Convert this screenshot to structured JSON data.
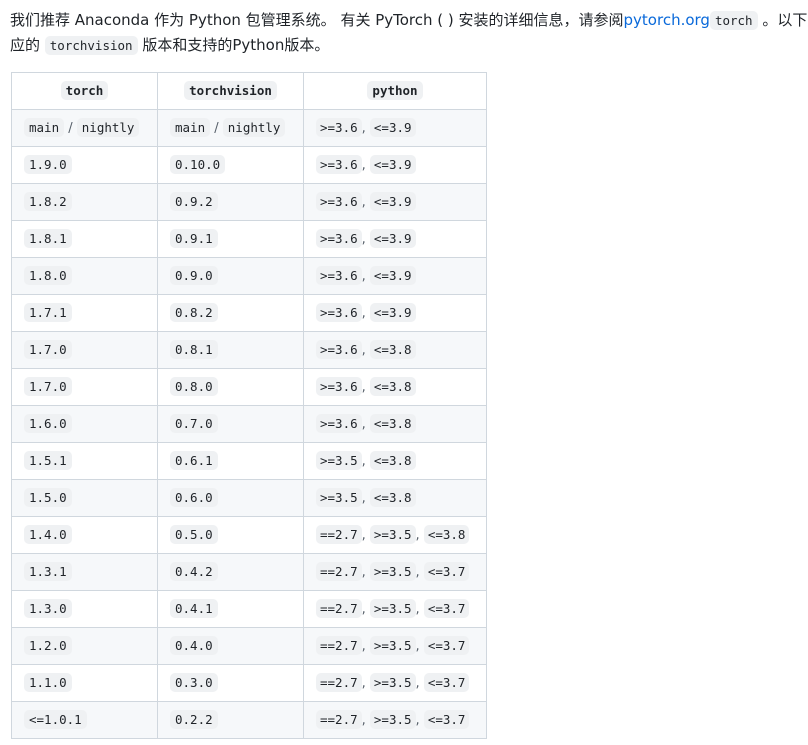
{
  "intro": {
    "line1_text": "我们推荐 Anaconda 作为 Python 包管理系统。 有关 PyTorch ( ) 安装的详细信息，请参阅",
    "link_text": "pytorch.org",
    "code_torch": "torch",
    "line1_tail": " 。以下是相",
    "line2_prefix": "应的 ",
    "code_torchvision": "torchvision",
    "line2_suffix": " 版本和支持的Python版本。"
  },
  "table": {
    "headers": [
      "torch",
      "torchvision",
      "python"
    ],
    "rows": [
      {
        "torch": [
          "main",
          "nightly"
        ],
        "torchvision": [
          "main",
          "nightly"
        ],
        "python": [
          ">=3.6",
          "<=3.9"
        ]
      },
      {
        "torch": [
          "1.9.0"
        ],
        "torchvision": [
          "0.10.0"
        ],
        "python": [
          ">=3.6",
          "<=3.9"
        ]
      },
      {
        "torch": [
          "1.8.2"
        ],
        "torchvision": [
          "0.9.2"
        ],
        "python": [
          ">=3.6",
          "<=3.9"
        ]
      },
      {
        "torch": [
          "1.8.1"
        ],
        "torchvision": [
          "0.9.1"
        ],
        "python": [
          ">=3.6",
          "<=3.9"
        ]
      },
      {
        "torch": [
          "1.8.0"
        ],
        "torchvision": [
          "0.9.0"
        ],
        "python": [
          ">=3.6",
          "<=3.9"
        ]
      },
      {
        "torch": [
          "1.7.1"
        ],
        "torchvision": [
          "0.8.2"
        ],
        "python": [
          ">=3.6",
          "<=3.9"
        ]
      },
      {
        "torch": [
          "1.7.0"
        ],
        "torchvision": [
          "0.8.1"
        ],
        "python": [
          ">=3.6",
          "<=3.8"
        ]
      },
      {
        "torch": [
          "1.7.0"
        ],
        "torchvision": [
          "0.8.0"
        ],
        "python": [
          ">=3.6",
          "<=3.8"
        ]
      },
      {
        "torch": [
          "1.6.0"
        ],
        "torchvision": [
          "0.7.0"
        ],
        "python": [
          ">=3.6",
          "<=3.8"
        ]
      },
      {
        "torch": [
          "1.5.1"
        ],
        "torchvision": [
          "0.6.1"
        ],
        "python": [
          ">=3.5",
          "<=3.8"
        ]
      },
      {
        "torch": [
          "1.5.0"
        ],
        "torchvision": [
          "0.6.0"
        ],
        "python": [
          ">=3.5",
          "<=3.8"
        ]
      },
      {
        "torch": [
          "1.4.0"
        ],
        "torchvision": [
          "0.5.0"
        ],
        "python": [
          "==2.7",
          ">=3.5",
          "<=3.8"
        ]
      },
      {
        "torch": [
          "1.3.1"
        ],
        "torchvision": [
          "0.4.2"
        ],
        "python": [
          "==2.7",
          ">=3.5",
          "<=3.7"
        ]
      },
      {
        "torch": [
          "1.3.0"
        ],
        "torchvision": [
          "0.4.1"
        ],
        "python": [
          "==2.7",
          ">=3.5",
          "<=3.7"
        ]
      },
      {
        "torch": [
          "1.2.0"
        ],
        "torchvision": [
          "0.4.0"
        ],
        "python": [
          "==2.7",
          ">=3.5",
          "<=3.7"
        ]
      },
      {
        "torch": [
          "1.1.0"
        ],
        "torchvision": [
          "0.3.0"
        ],
        "python": [
          "==2.7",
          ">=3.5",
          "<=3.7"
        ]
      },
      {
        "torch": [
          "<=1.0.1"
        ],
        "torchvision": [
          "0.2.2"
        ],
        "python": [
          "==2.7",
          ">=3.5",
          "<=3.7"
        ]
      }
    ]
  },
  "colors": {
    "link": "#0969da",
    "code_bg": "#eff1f3",
    "border": "#d0d7de",
    "stripe": "#f6f8fa"
  }
}
